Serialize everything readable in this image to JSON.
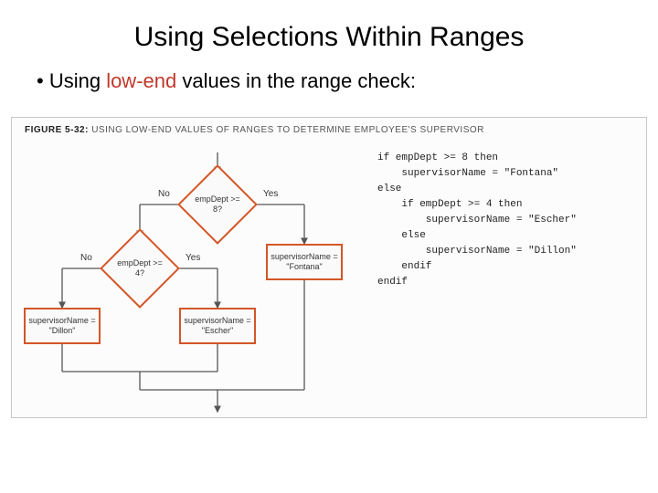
{
  "title": "Using Selections Within Ranges",
  "bullet_prefix": "Using ",
  "bullet_highlight": "low-end",
  "bullet_suffix": " values in the range check:",
  "figure": {
    "label": "FIGURE 5-32:",
    "caption": "USING LOW-END VALUES OF RANGES TO DETERMINE EMPLOYEE'S SUPERVISOR"
  },
  "flowchart": {
    "decision1": "empDept\n>= 8?",
    "decision2": "empDept\n>= 4?",
    "yes": "Yes",
    "no": "No",
    "box_fontana": "supervisorName\n= \"Fontana\"",
    "box_escher": "supervisorName\n= \"Escher\"",
    "box_dillon": "supervisorName\n= \"Dillon\""
  },
  "pseudocode": "if empDept >= 8 then\n    supervisorName = \"Fontana\"\nelse\n    if empDept >= 4 then\n        supervisorName = \"Escher\"\n    else\n        supervisorName = \"Dillon\"\n    endif\nendif"
}
